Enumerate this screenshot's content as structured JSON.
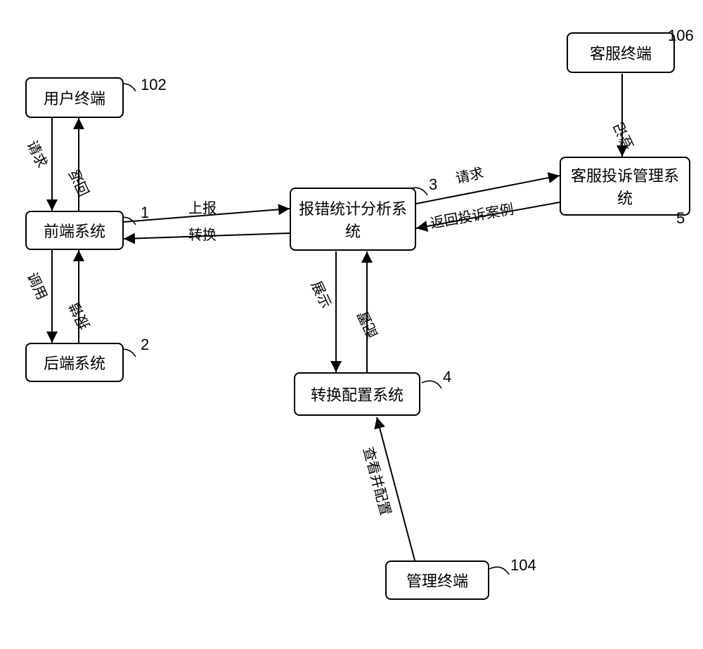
{
  "nodes": {
    "user_terminal": {
      "label": "用户终端",
      "ref": "102"
    },
    "frontend": {
      "label": "前端系统",
      "ref": "1"
    },
    "backend": {
      "label": "后端系统",
      "ref": "2"
    },
    "analysis": {
      "label": "报错统计分析系统",
      "ref": "3"
    },
    "config": {
      "label": "转换配置系统",
      "ref": "4"
    },
    "complaint": {
      "label": "客服投诉管理系统",
      "ref": "5"
    },
    "cs_terminal": {
      "label": "客服终端",
      "ref": "106"
    },
    "admin_terminal": {
      "label": "管理终端",
      "ref": "104"
    }
  },
  "edges": {
    "request_user_frontend": "请求",
    "return_frontend_user": "回返",
    "call_frontend_backend": "调用",
    "error_backend_frontend": "报错",
    "report_frontend_analysis": "上报",
    "transform_analysis_frontend": "转换",
    "display_analysis_config": "展示",
    "configure_config_analysis": "配置",
    "request_analysis_complaint": "请求",
    "return_complaint_analysis": "返回投诉案例",
    "register_csterm_complaint": "登记",
    "view_configure_admin_config": "查看并配置"
  }
}
